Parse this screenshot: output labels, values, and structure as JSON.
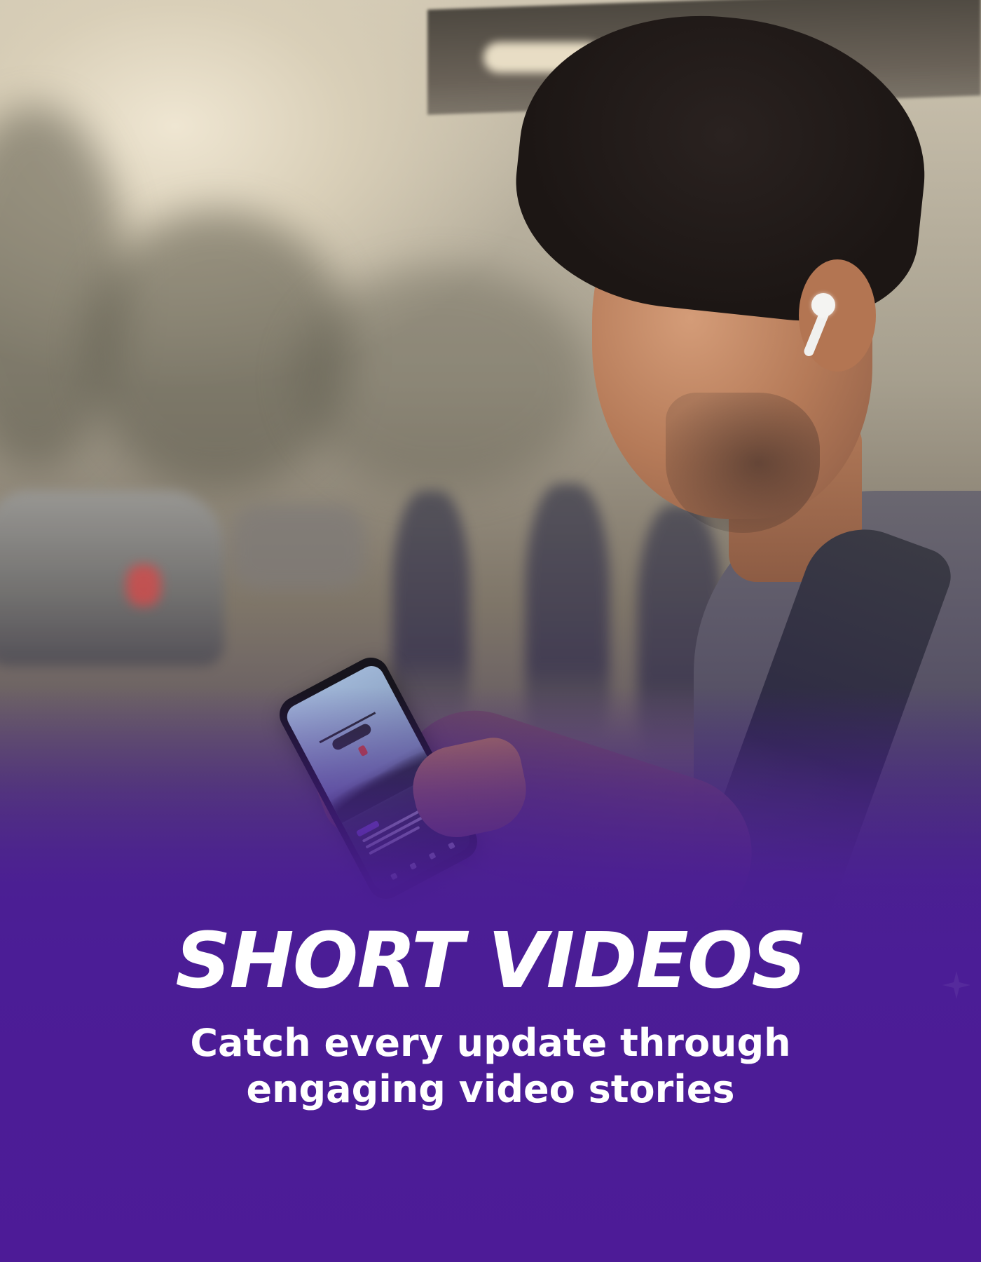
{
  "hero": {
    "title": "SHORT VIDEOS",
    "subtitle_line1": "Catch every update through",
    "subtitle_line2": "engaging video stories"
  },
  "colors": {
    "background_purple": "#4b1d96",
    "text": "#ffffff"
  },
  "image": {
    "subject": "man-with-phone-and-earbud-photo"
  }
}
